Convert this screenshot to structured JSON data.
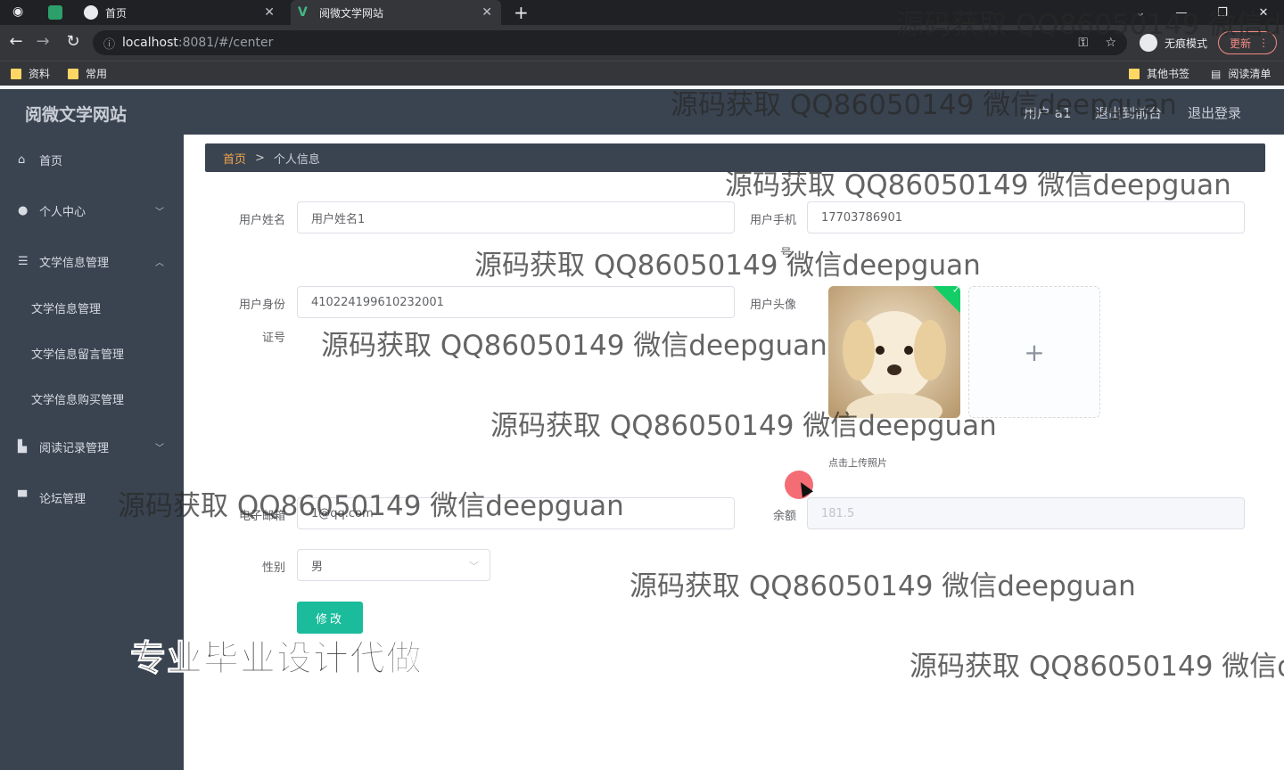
{
  "browser": {
    "tabs": [
      {
        "label": "首页"
      },
      {
        "label": "阅微文学网站"
      }
    ],
    "url_host": "localhost",
    "url_rest": ":8081/#/center",
    "incognito_label": "无痕模式",
    "update_label": "更新",
    "bookmarks": [
      "资料",
      "常用"
    ],
    "bookmarks_right": [
      "其他书签",
      "阅读清单"
    ]
  },
  "header": {
    "title": "阅微文学网站",
    "user": "用户 a1",
    "to_front": "退出到前台",
    "logout": "退出登录"
  },
  "sidebar": {
    "items": [
      {
        "label": "首页"
      },
      {
        "label": "个人中心"
      },
      {
        "label": "文学信息管理"
      },
      {
        "label": "文学信息管理"
      },
      {
        "label": "文学信息留言管理"
      },
      {
        "label": "文学信息购买管理"
      },
      {
        "label": "阅读记录管理"
      },
      {
        "label": "论坛管理"
      }
    ]
  },
  "breadcrumb": {
    "home": "首页",
    "sep": ">",
    "current": "个人信息"
  },
  "form": {
    "username_label": "用户姓名",
    "username_value": "用户姓名1",
    "phone_label": "用户手机",
    "phone_label_wrap": "号",
    "phone_value": "17703786901",
    "idcard_label": "用户身份",
    "idcard_label_wrap": "证号",
    "idcard_value": "410224199610232001",
    "avatar_label": "用户头像",
    "upload_tip": "点击上传照片",
    "email_label": "电子邮箱",
    "email_value": "1@qq.com",
    "balance_label": "余额",
    "balance_value": "181.5",
    "gender_label": "性别",
    "gender_value": "男",
    "submit_label": "修改"
  },
  "watermarks": {
    "text": "源码获取 QQ86050149 微信deepguan",
    "banner": "专业毕业设计代做"
  },
  "colors": {
    "sidebar_bg": "#3a4451",
    "accent": "#1abc9c",
    "breadcrumb_home": "#f0a44b"
  }
}
